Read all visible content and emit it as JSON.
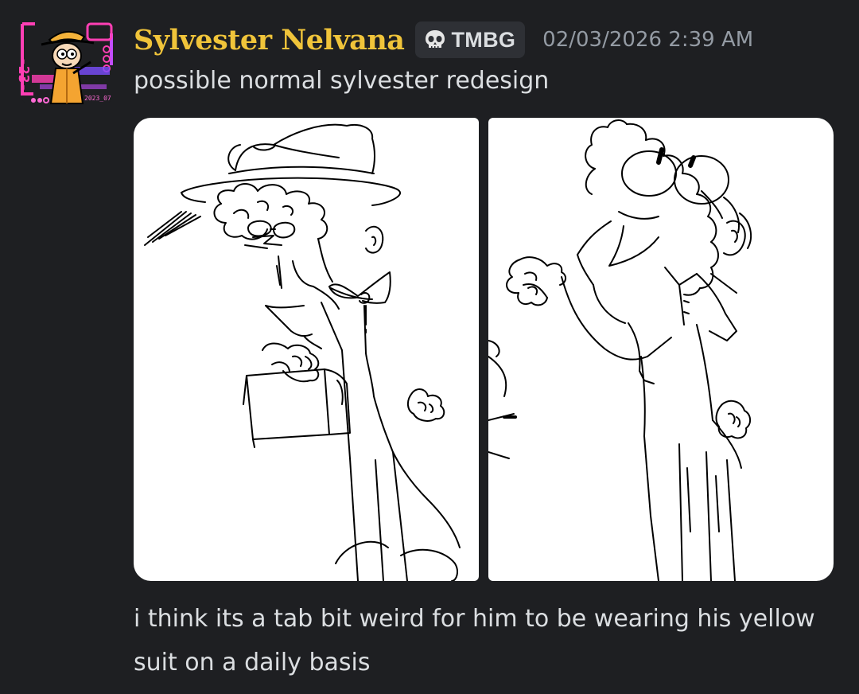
{
  "message": {
    "author": {
      "name": "Sylvester Nelvana",
      "name_color": "#f0c43a",
      "avatar_icon": "cartoon-character-avatar",
      "avatar_badge_text": "-23-"
    },
    "tag": {
      "icon": "skull-icon",
      "label": "TMBG"
    },
    "timestamp": "02/03/2026 2:39 AM",
    "content_lines": [
      "possible normal sylvester redesign"
    ],
    "attachments": [
      {
        "name": "sketch-1",
        "description_icon": "character-sketch-with-hat-and-briefcase"
      },
      {
        "name": "sketch-2",
        "description_icon": "character-sketch-curly-hair-shrug"
      }
    ],
    "followup_text": "i think its a tab bit weird for him to be wearing his yellow suit on a daily basis"
  },
  "colors": {
    "background": "#1e1f22",
    "text": "#dbdee1",
    "muted": "#949ba4",
    "tag_background": "#2e3035",
    "username": "#f0c43a"
  }
}
